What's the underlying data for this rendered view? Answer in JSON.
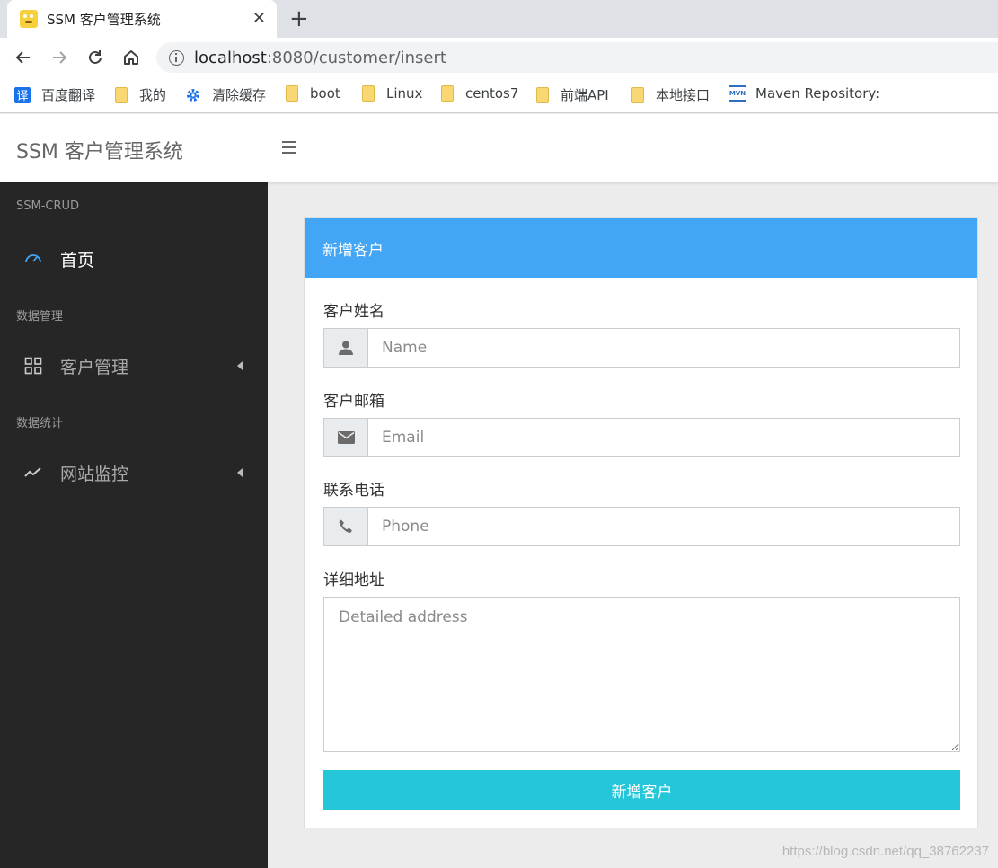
{
  "browser": {
    "tab_title": "SSM 客户管理系统",
    "close_glyph": "✕",
    "new_tab_glyph": "+",
    "url_host": "localhost",
    "url_rest": ":8080/customer/insert"
  },
  "bookmarks": [
    {
      "label": "百度翻译",
      "icon": "translate-icon"
    },
    {
      "label": "我的",
      "icon": "folder-icon"
    },
    {
      "label": "清除缓存",
      "icon": "gear-icon"
    },
    {
      "label": "boot",
      "icon": "folder-icon"
    },
    {
      "label": "Linux",
      "icon": "folder-icon"
    },
    {
      "label": "centos7",
      "icon": "folder-icon"
    },
    {
      "label": "前端API",
      "icon": "folder-icon"
    },
    {
      "label": "本地接口",
      "icon": "folder-icon"
    },
    {
      "label": "Maven Repository:",
      "icon": "maven-icon"
    }
  ],
  "bookmark_glyphs": {
    "translate": "译",
    "maven": "MVN"
  },
  "app": {
    "logo": "SSM 客户管理系统"
  },
  "sidebar": {
    "section_1": "SSM-CRUD",
    "home": "首页",
    "section_2": "数据管理",
    "customer_mgmt": "客户管理",
    "section_3": "数据统计",
    "site_monitor": "网站监控"
  },
  "form": {
    "title": "新增客户",
    "name_label": "客户姓名",
    "name_placeholder": "Name",
    "email_label": "客户邮箱",
    "email_placeholder": "Email",
    "phone_label": "联系电话",
    "phone_placeholder": "Phone",
    "address_label": "详细地址",
    "address_placeholder": "Detailed address",
    "submit_label": "新增客户"
  },
  "watermark": "https://blog.csdn.net/qq_38762237",
  "colors": {
    "accent": "#42a5f5",
    "submit": "#26c6da",
    "sidebar": "#262626"
  }
}
